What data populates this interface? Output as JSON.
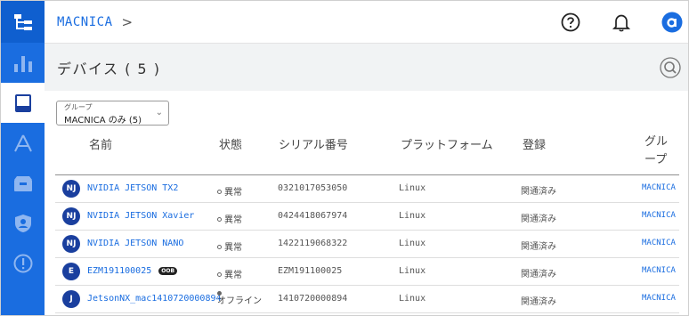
{
  "header": {
    "org_name": "MACNICA",
    "org_chevron": ">"
  },
  "page": {
    "title": "デバイス ( 5 )"
  },
  "group_select": {
    "label": "グループ",
    "value": "MACNICA のみ (5)"
  },
  "table": {
    "columns": {
      "name": "名前",
      "status": "状態",
      "serial": "シリアル番号",
      "platform": "プラットフォーム",
      "registration": "登録",
      "group_line1": "グル",
      "group_line2": "ープ"
    },
    "rows": [
      {
        "initials": "NJ",
        "name": "NVIDIA JETSON TX2",
        "badge": "",
        "status": "異常",
        "serial": "0321017053050",
        "platform": "Linux",
        "registration": "関通済み",
        "group": "MACNICA"
      },
      {
        "initials": "NJ",
        "name": "NVIDIA JETSON Xavier",
        "badge": "",
        "status": "異常",
        "serial": "0424418067974",
        "platform": "Linux",
        "registration": "関通済み",
        "group": "MACNICA"
      },
      {
        "initials": "NJ",
        "name": "NVIDIA JETSON NANO",
        "badge": "",
        "status": "異常",
        "serial": "1422119068322",
        "platform": "Linux",
        "registration": "関通済み",
        "group": "MACNICA"
      },
      {
        "initials": "E",
        "name": "EZM191100025",
        "badge": "OOB",
        "status": "異常",
        "serial": "EZM191100025",
        "platform": "Linux",
        "registration": "関通済み",
        "group": "MACNICA"
      },
      {
        "initials": "J",
        "name": "JetsonNX_mac1410720000894",
        "badge": "",
        "status": "オフライン",
        "serial": "1410720000894",
        "platform": "Linux",
        "registration": "関通済み",
        "group": "MACNICA"
      }
    ]
  },
  "icons": {
    "rail": [
      "hierarchy-icon",
      "bar-chart-icon",
      "device-icon",
      "deploy-icon",
      "inbox-icon",
      "shield-user-icon",
      "alert-icon"
    ],
    "header": [
      "help-icon",
      "bell-icon",
      "account-icon"
    ]
  },
  "colors": {
    "accent": "#1a6de0",
    "rail": "#1a6de0",
    "avatar": "#1a3f9e"
  }
}
